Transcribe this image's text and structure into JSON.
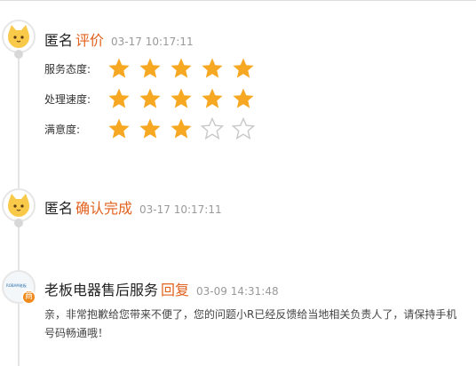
{
  "entries": [
    {
      "author": "匿名",
      "action": "评价",
      "time": "03-17 10:17:11",
      "ratings": [
        {
          "label": "服务态度:",
          "stars": 5,
          "max": 5
        },
        {
          "label": "处理速度:",
          "stars": 5,
          "max": 5
        },
        {
          "label": "满意度:",
          "stars": 3,
          "max": 5
        }
      ]
    },
    {
      "author": "匿名",
      "action": "确认完成",
      "time": "03-17 10:17:11"
    },
    {
      "author": "老板电器售后服务",
      "action": "回复",
      "time": "03-09 14:31:48",
      "logo_text": "ROBAM老板",
      "badge": "商",
      "content": "亲，非常抱歉给您带来不便了，您的问题小R已经反馈给当地相关负责人了，请保持手机号码畅通哦！"
    }
  ],
  "colors": {
    "accent": "#e2611d",
    "star_filled": "#f7a823",
    "star_empty": "#c8c8c8",
    "avatar_cat": "#f9c94a",
    "badge": "#f08a1c"
  },
  "icons": {
    "user_avatar": "cat-face-icon",
    "star_filled": "star-filled-icon",
    "star_empty": "star-outline-icon"
  }
}
